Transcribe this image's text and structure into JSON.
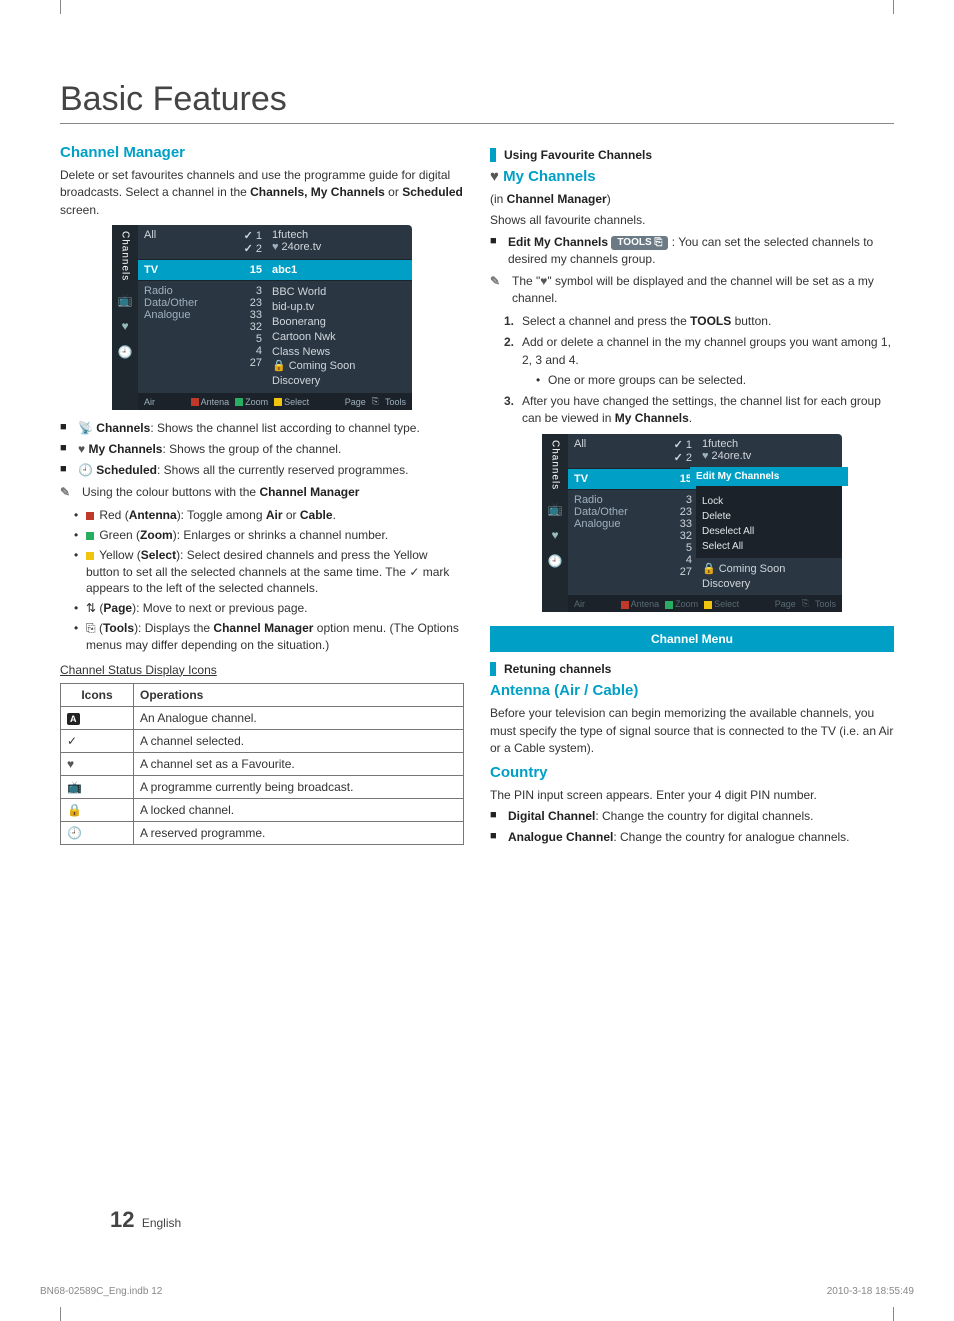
{
  "title": "Basic Features",
  "left": {
    "h": "Channel Manager",
    "intro_a": "Delete or set favourites channels and use the programme guide for digital broadcasts. Select a channel in the ",
    "intro_b": "Channels, My Channels",
    "intro_c": " or ",
    "intro_d": "Scheduled",
    "intro_e": " screen.",
    "tv1": {
      "side": "Channels",
      "all": "All",
      "fav1_no": "1",
      "fav1_name": "1futech",
      "fav2_no": "2",
      "fav2_name": "24ore.tv",
      "hl_label": "TV",
      "hl_no": "15",
      "hl_name": "abc1",
      "c1": [
        "Radio",
        "Data/Other",
        "Analogue"
      ],
      "c2": [
        "3",
        "23",
        "33",
        "32",
        "5",
        "4",
        "27"
      ],
      "c3": [
        "BBC World",
        "bid-up.tv",
        "Boonerang",
        "Cartoon Nwk",
        "Class News",
        "Coming Soon",
        "Discovery"
      ],
      "locked": "Coming Soon",
      "foot_air": "Air",
      "fA": "Antena",
      "fB": "Zoom",
      "fC": "Select",
      "fPage": "Page",
      "fTools": "Tools"
    },
    "b1a": "Channels",
    "b1b": ": Shows the channel list according to channel type.",
    "b2a": "My Channels",
    "b2b": ": Shows the group of the channel.",
    "b3a": "Scheduled",
    "b3b": ": Shows all the currently reserved programmes.",
    "note1a": "Using the colour buttons with the ",
    "note1b": "Channel Manager",
    "d1a": "Red (",
    "d1b": "Antenna",
    "d1c": "): Toggle among ",
    "d1d": "Air",
    "d1e": " or ",
    "d1f": "Cable",
    "d1g": ".",
    "d2a": "Green (",
    "d2b": "Zoom",
    "d2c": "): Enlarges or shrinks a channel number.",
    "d3a": "Yellow (",
    "d3b": "Select",
    "d3c": "): Select desired channels and press the Yellow button to set all the selected channels at the same time. The ",
    "d3d": " mark appears to the left of the selected channels.",
    "d4a": "(",
    "d4b": "Page",
    "d4c": "): Move to next or previous page.",
    "d5a": "(",
    "d5b": "Tools",
    "d5c": "): Displays the ",
    "d5d": "Channel Manager",
    "d5e": " option menu. (The Options menus may differ depending on the situation.)",
    "table_title": "Channel Status Display Icons",
    "th1": "Icons",
    "th2": "Operations",
    "rows": [
      {
        "icon": "A",
        "op": "An Analogue channel."
      },
      {
        "icon": "✓",
        "op": "A channel selected."
      },
      {
        "icon": "♥",
        "op": "A channel set as a Favourite."
      },
      {
        "icon": "📺",
        "op": "A programme currently being broadcast."
      },
      {
        "icon": "🔒",
        "op": "A locked channel."
      },
      {
        "icon": "🕘",
        "op": "A reserved programme."
      }
    ]
  },
  "right": {
    "sec1": "Using Favourite Channels",
    "mych": "My Channels",
    "in_a": "(in ",
    "in_b": "Channel Manager",
    "in_c": ")",
    "shows": "Shows all favourite channels.",
    "edit_a": "Edit My Channels",
    "tools": "TOOLS",
    "edit_b": " : You can set the selected channels to desired my channels group.",
    "note_a": "The \"",
    "note_b": "\" symbol will be displayed and the channel will be set as a my channel.",
    "s1a": "Select a channel and press the ",
    "s1b": "TOOLS",
    "s1c": " button.",
    "s2": "Add or delete a channel in the my channel groups you want among 1, 2, 3 and 4.",
    "s2d": "One or more groups can be selected.",
    "s3a": "After you have changed the settings, the channel list for each group can be viewed in ",
    "s3b": "My Channels",
    "s3c": ".",
    "tv2": {
      "side": "Channels",
      "all": "All",
      "fav1_no": "1",
      "fav1_name": "1futech",
      "fav2_no": "2",
      "fav2_name": "24ore.tv",
      "hl_label": "TV",
      "hl_no": "15",
      "menu_hi": "Edit My Channels",
      "menu": [
        "Lock",
        "Delete",
        "Deselect All",
        "Select All"
      ],
      "c1": [
        "Radio",
        "Data/Other",
        "Analogue"
      ],
      "c2": [
        "3",
        "23",
        "33",
        "32",
        "5",
        "4",
        "27"
      ],
      "lock_name": "Coming Soon",
      "last": "Discovery",
      "foot_air": "Air",
      "fA": "Antena",
      "fB": "Zoom",
      "fC": "Select",
      "fPage": "Page",
      "fTools": "Tools"
    },
    "band": "Channel Menu",
    "sec2": "Retuning channels",
    "h3": "Antenna (Air / Cable)",
    "ant": "Before your television can begin memorizing the available channels, you must specify the type of signal source that is connected to the TV (i.e. an Air or a Cable system).",
    "h4": "Country",
    "pin": "The PIN input screen appears. Enter your 4 digit PIN number.",
    "cb1a": "Digital Channel",
    "cb1b": ": Change the country for digital channels.",
    "cb2a": "Analogue Channel",
    "cb2b": ": Change the country for analogue channels."
  },
  "page_no": "12",
  "page_lang": "English",
  "doc_id": "BN68-02589C_Eng.indb   12",
  "doc_ts": "2010-3-18   18:55:49"
}
